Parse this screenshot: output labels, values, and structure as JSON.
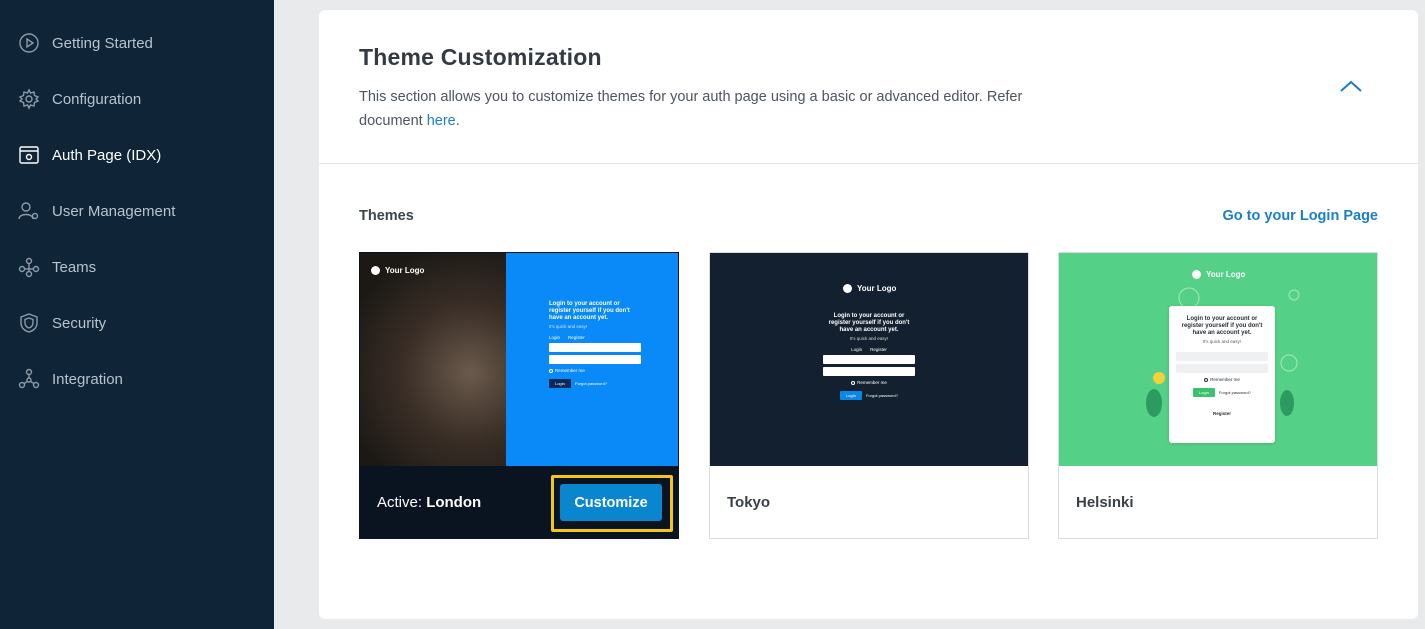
{
  "sidebar": {
    "items": [
      {
        "label": "Getting Started",
        "icon": "play-circle-icon"
      },
      {
        "label": "Configuration",
        "icon": "gear-icon"
      },
      {
        "label": "Auth Page (IDX)",
        "icon": "browser-gear-icon",
        "active": true
      },
      {
        "label": "User Management",
        "icon": "user-gear-icon"
      },
      {
        "label": "Teams",
        "icon": "team-icon"
      },
      {
        "label": "Security",
        "icon": "shield-icon"
      },
      {
        "label": "Integration",
        "icon": "network-icon"
      }
    ]
  },
  "section": {
    "title": "Theme Customization",
    "description": "This section allows you to customize themes for your auth page using a basic or advanced editor. Refer document ",
    "link_text": "here",
    "description_end": "."
  },
  "themes": {
    "label": "Themes",
    "login_link": "Go to your Login Page",
    "active_prefix": "Active: ",
    "customize_label": "Customize",
    "items": [
      {
        "name": "London",
        "active": true
      },
      {
        "name": "Tokyo"
      },
      {
        "name": "Helsinki"
      }
    ],
    "preview": {
      "logo": "Your Logo",
      "heading": "Login to your account or register yourself if you don't have an account yet.",
      "sub": "It's quick and easy!",
      "tab_login": "Login",
      "tab_register": "Register",
      "email": "Email",
      "password": "Password",
      "remember": "Remember me",
      "button": "Login",
      "forgot": "Forgot password?",
      "register_link": "Register"
    }
  },
  "colors": {
    "sidebar_bg": "#0f2436",
    "accent": "#1b7fc4",
    "highlight": "#f5c518",
    "london_blue": "#0a8af8",
    "tokyo_bg": "#13202f",
    "helsinki_bg": "#54d186"
  }
}
